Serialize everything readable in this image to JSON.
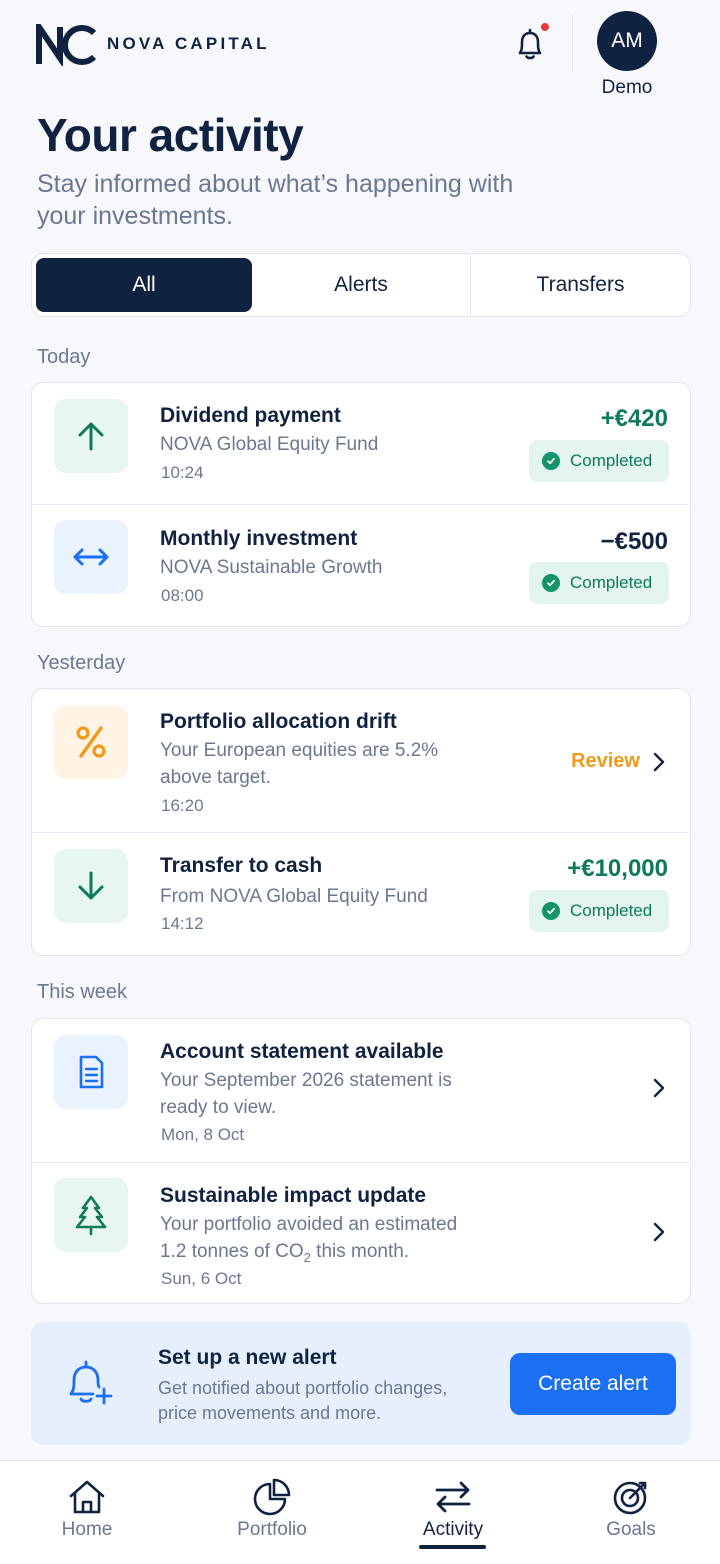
{
  "brand": {
    "name": "NOVA CAPITAL"
  },
  "header": {
    "avatar_initials": "AM",
    "avatar_label": "Demo",
    "notification_dot": true
  },
  "page": {
    "title": "Your activity",
    "subtitle": "Stay informed about what’s happening with your investments."
  },
  "tabs": [
    {
      "label": "All",
      "active": true
    },
    {
      "label": "Alerts",
      "active": false
    },
    {
      "label": "Transfers",
      "active": false
    }
  ],
  "sections": {
    "today": {
      "label": "Today",
      "items": [
        {
          "title": "Dividend payment",
          "subtitle": "NOVA Global Equity Fund",
          "time": "10:24",
          "amount": "+€420",
          "status": "Completed",
          "icon": "arrow-up-icon"
        },
        {
          "title": "Monthly investment",
          "subtitle": "NOVA Sustainable Growth",
          "time": "08:00",
          "amount": "−€500",
          "status": "Completed",
          "icon": "arrows-left-right-icon"
        }
      ]
    },
    "yesterday": {
      "label": "Yesterday",
      "items": [
        {
          "title": "Portfolio allocation drift",
          "subtitle": "Your European equities are 5.2% above target.",
          "time": "16:20",
          "action": "Review",
          "icon": "percent-icon"
        },
        {
          "title": "Transfer to cash",
          "subtitle": "From NOVA Global Equity Fund",
          "time": "14:12",
          "amount": "+€10,000",
          "status": "Completed",
          "icon": "arrow-down-icon"
        }
      ]
    },
    "this_week": {
      "label": "This week",
      "items": [
        {
          "title": "Account statement available",
          "subtitle": "Your September 2026 statement is ready to view.",
          "time": "Mon, 8 Oct",
          "icon": "document-icon"
        },
        {
          "title": "Sustainable impact update",
          "subtitle_line1": "Your portfolio avoided an estimated",
          "subtitle_line2_prefix": "1.2 tonnes of CO",
          "subtitle_line2_sub": "2",
          "subtitle_line2_suffix": " this month.",
          "time": "Sun, 6 Oct",
          "icon": "tree-icon"
        }
      ]
    }
  },
  "promo": {
    "title": "Set up a new alert",
    "text": "Get notified about portfolio changes, price movements and more.",
    "button": "Create alert"
  },
  "nav": [
    {
      "label": "Home",
      "icon": "home-icon",
      "active": false
    },
    {
      "label": "Portfolio",
      "icon": "pie-chart-icon",
      "active": false
    },
    {
      "label": "Activity",
      "icon": "transfer-arrows-icon",
      "active": true
    },
    {
      "label": "Goals",
      "icon": "target-icon",
      "active": false
    }
  ],
  "colors": {
    "navy": "#0f2240",
    "positive": "#0e7a5a",
    "warning": "#f29a17",
    "accent": "#1a6ff2",
    "alert_dot": "#e53935"
  }
}
